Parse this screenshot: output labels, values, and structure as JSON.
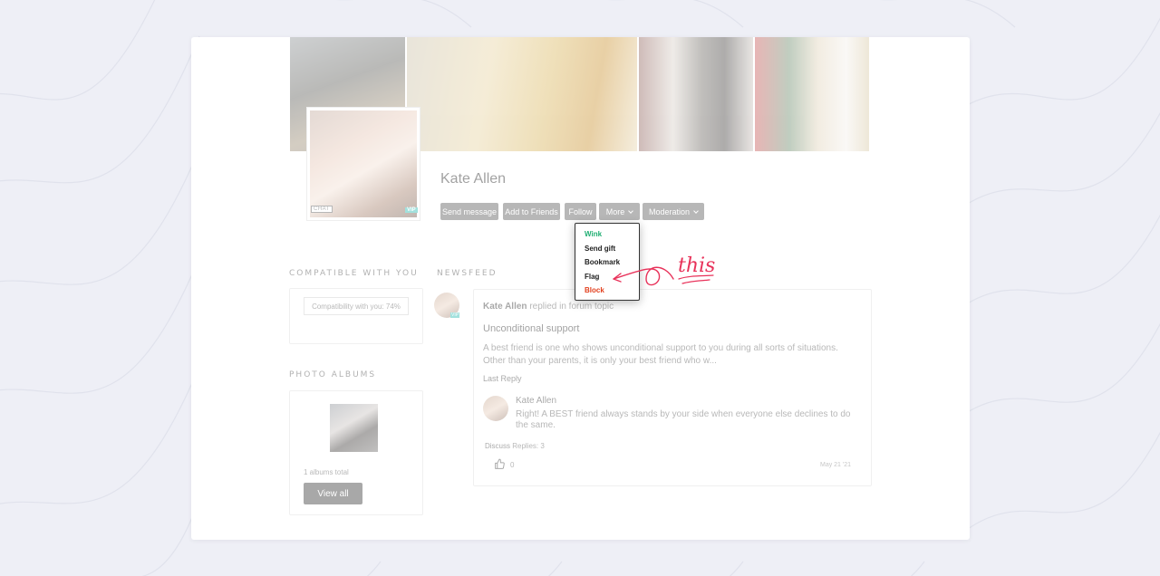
{
  "profile": {
    "name": "Kate Allen",
    "chat_badge": "CHAT",
    "vip_badge": "VIP"
  },
  "actions": {
    "send_message": "Send message",
    "add_to_friends": "Add to Friends",
    "follow": "Follow",
    "more": "More",
    "moderation": "Moderation"
  },
  "more_menu": {
    "items": [
      "Wink",
      "Send gift",
      "Bookmark",
      "Flag",
      "Block"
    ],
    "colors": {
      "Wink": "#1fae72",
      "Block": "#e2401e",
      "default": "#222222"
    }
  },
  "sidebar": {
    "compatible_title": "COMPATIBLE WITH YOU",
    "compatibility_text": "Compatibility with you: 74%",
    "albums_title": "PHOTO ALBUMS",
    "albums_total": "1 albums total",
    "view_all": "View all"
  },
  "newsfeed": {
    "title": "NEWSFEED",
    "author": "Kate Allen",
    "action": "replied in forum topic",
    "vip_badge": "VIP",
    "topic_title": "Unconditional support",
    "excerpt_line1": "A best friend is one who shows unconditional support to you during all sorts of situations.",
    "excerpt_line2": "Other than your parents, it is only your best friend who w...",
    "last_reply_label": "Last Reply",
    "reply_author": "Kate Allen",
    "reply_line1": "Right! A BEST friend always stands by your side when everyone else declines to do",
    "reply_line2": "the same.",
    "discuss_label": "Discuss",
    "replies_label": "Replies: 3",
    "likes": "0",
    "date": "May 21 '21"
  },
  "annotation": {
    "text": "this",
    "color": "#e8325a"
  }
}
